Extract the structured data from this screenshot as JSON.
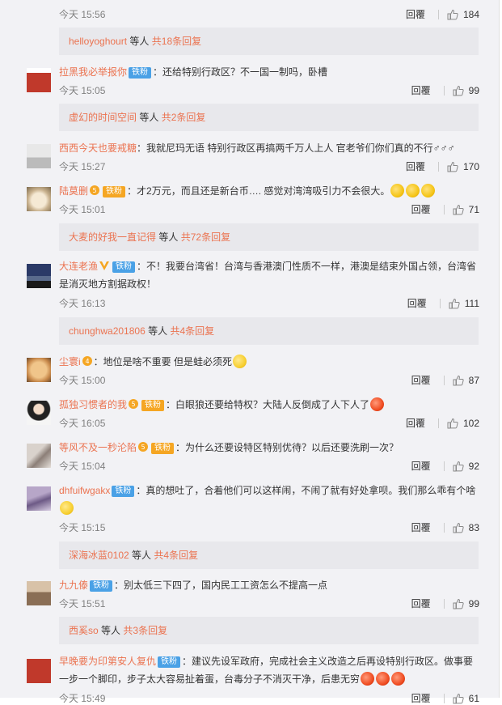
{
  "top": {
    "time": "今天 15:56",
    "reply": "回覆",
    "likes": "184"
  },
  "common": {
    "reply": "回覆",
    "people_suffix": "等人",
    "total_prefix": "共",
    "total_suffix": "条回复"
  },
  "subreply_0": {
    "user": "helloyoghourt",
    "count": "18"
  },
  "comments": [
    {
      "user": "拉黑我必举报你",
      "badge": "铁粉",
      "text": "：还给特别行政区？不一国一制吗，卧槽",
      "time": "今天 15:05",
      "likes": "99"
    },
    {
      "user": "西西今天也要戒糖",
      "text": "：我就尼玛无语 特别行政区再搞两千万人上人 官老爷们你们真的不行♂♂♂",
      "time": "今天 15:27",
      "likes": "170"
    },
    {
      "user": "陆莫删",
      "badge": "铁粉",
      "text": "：才2万元，而且还是新台币…. 感觉对湾湾吸引力不会很大。",
      "time": "今天 15:01",
      "likes": "71"
    },
    {
      "user": "大连老渔",
      "badge": "铁粉",
      "text": "：不！我要台湾省！台湾与香港澳门性质不一样，港澳是结束外国占领，台湾省是消灭地方割据政权！",
      "time": "今天 16:13",
      "likes": "111"
    },
    {
      "user": "尘寰i",
      "text": "：地位是啥不重要 但是蛙必须死",
      "time": "今天 15:00",
      "likes": "87"
    },
    {
      "user": "孤独习惯者的我",
      "badge": "铁粉",
      "text": "：白眼狼还要给特权？大陆人反倒成了人下人了",
      "time": "今天 16:05",
      "likes": "102"
    },
    {
      "user": "等风不及一秒沦陷",
      "badge": "铁粉",
      "text": "：为什么还要设特区特别优待？以后还要洗刷一次？",
      "time": "今天 15:04",
      "likes": "92"
    },
    {
      "user": "dhfuifwgakx",
      "badge": "铁粉",
      "text": "：真的想吐了，合着他们可以这样闹，不闹了就有好处拿呗。我们那么乖有个啥",
      "time": "今天 15:15",
      "likes": "83"
    },
    {
      "user": "九九傣",
      "badge": "铁粉",
      "text": "：别太低三下四了，国内民工工资怎么不提高一点",
      "time": "今天 15:51",
      "likes": "99"
    },
    {
      "user": "早晚要为印第安人复仇",
      "badge": "铁粉",
      "text": "：建议先设军政府，完成社会主义改造之后再设特别行政区。做事要一步一个脚印，步子太大容易扯着蛋，台毒分子不消灭干净，后患无穷",
      "time": "今天 15:49",
      "likes": "61"
    }
  ],
  "subreplies": [
    {
      "user": "虚幻的时间空间",
      "count": "2"
    },
    {
      "user": "大麦的好我一直记得",
      "count": "72"
    },
    {
      "user": "chunghwa201806",
      "count": "4"
    },
    {
      "user": "深海冰蓝0102",
      "count": "4"
    },
    {
      "user": "西奚so",
      "count": "3"
    }
  ]
}
